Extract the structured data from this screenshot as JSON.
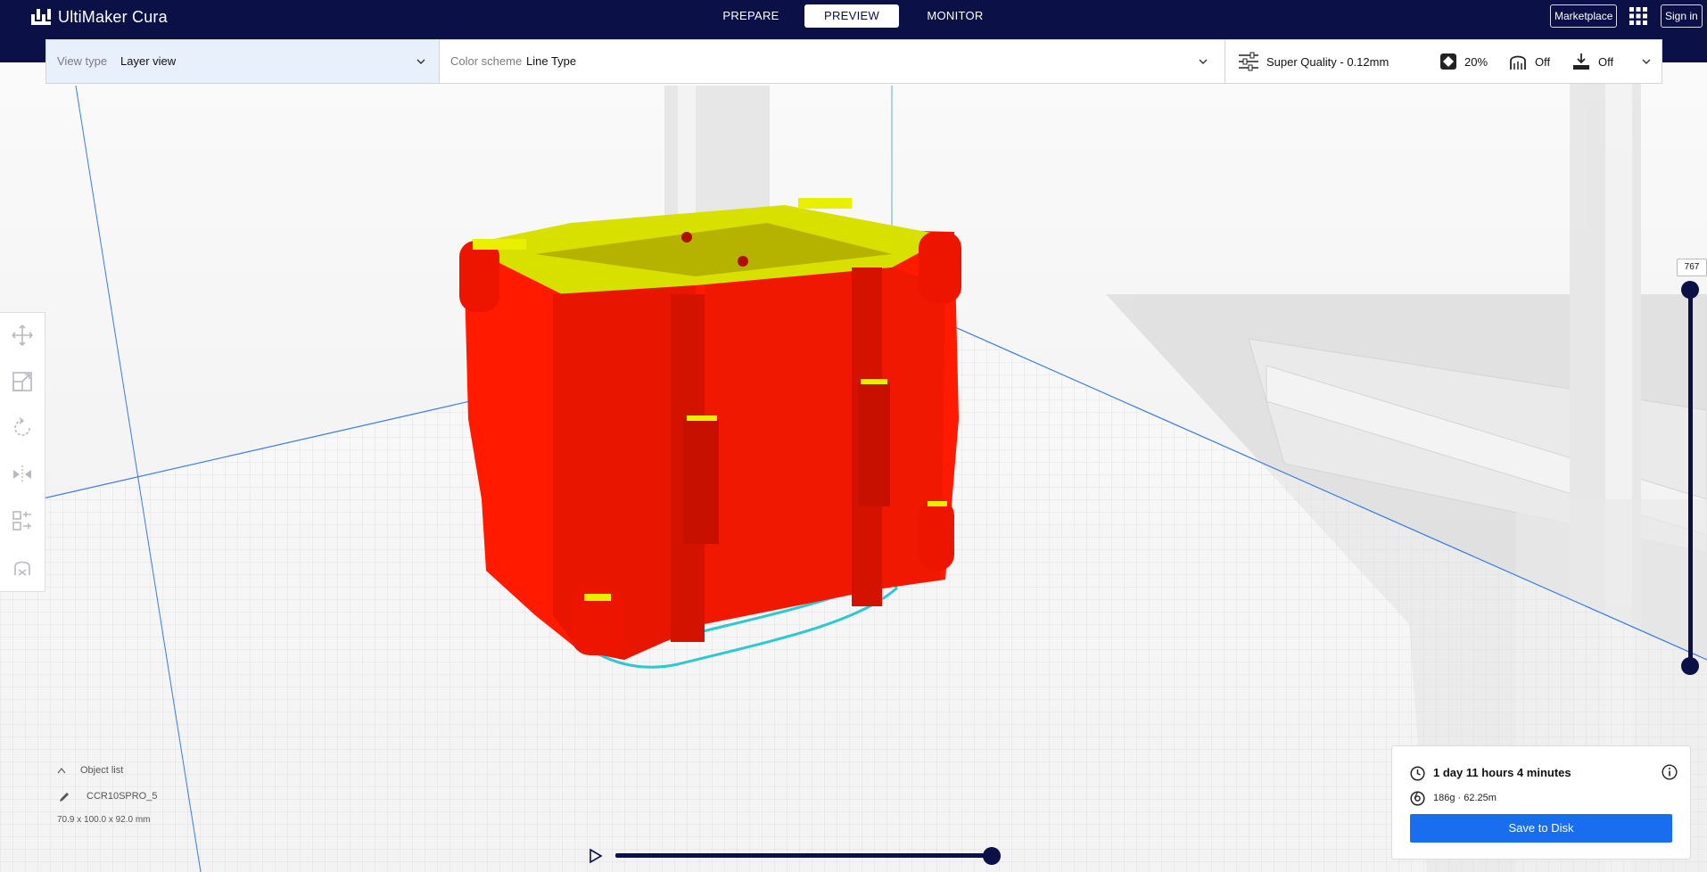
{
  "app": {
    "name": "UltiMaker Cura"
  },
  "stages": {
    "prepare": "PREPARE",
    "preview": "PREVIEW",
    "monitor": "MONITOR"
  },
  "header": {
    "marketplace": "Marketplace",
    "sign_in": "Sign in"
  },
  "view_toolbar": {
    "view_type_label": "View type",
    "view_type_value": "Layer view",
    "color_scheme_label": "Color scheme",
    "color_scheme_value": "Line Type"
  },
  "print_setup": {
    "profile": "Super Quality - 0.12mm",
    "infill": "20%",
    "support": "Off",
    "adhesion": "Off"
  },
  "layer_slider": {
    "current_layer": "767",
    "max_layer": 767,
    "min_layer": 1
  },
  "object_list": {
    "label": "Object list",
    "object_name": "CCR10SPRO_5",
    "dimensions": "70.9 x 100.0 x 92.0 mm"
  },
  "print_info": {
    "time": "1 day 11 hours 4 minutes",
    "material": "186g · 62.25m",
    "save_label": "Save to Disk"
  },
  "colors": {
    "header_bg": "#0b1046",
    "accent_blue": "#196ef0",
    "model_red": "#ff1a00",
    "model_yellow": "#d8e000",
    "skirt_cyan": "#2ec8d0"
  },
  "icons": {
    "tools": [
      "move-icon",
      "scale-icon",
      "rotate-icon",
      "mirror-icon",
      "per-model-settings-icon",
      "support-blocker-icon"
    ],
    "view_cubes": [
      "3d-view-icon",
      "front-view-icon",
      "top-view-icon",
      "left-view-icon",
      "right-view-icon"
    ]
  }
}
